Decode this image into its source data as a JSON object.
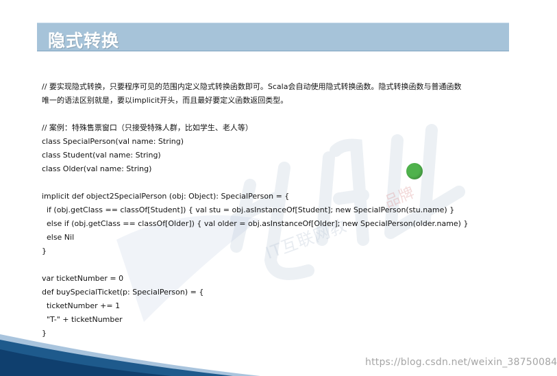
{
  "slide": {
    "title": "隐式转换",
    "lines": [
      "// 要实现隐式转换，只要程序可见的范围内定义隐式转换函数即可。Scala会自动使用隐式转换函数。隐式转换函数与普通函数",
      "唯一的语法区别就是，要以implicit开头，而且最好要定义函数返回类型。",
      "",
      "// 案例：特殊售票窗口（只接受特殊人群，比如学生、老人等）",
      "class SpecialPerson(val name: String)",
      "class Student(val name: String)",
      "class Older(val name: String)",
      "",
      "implicit def object2SpecialPerson (obj: Object): SpecialPerson = {",
      "  if (obj.getClass == classOf[Student]) { val stu = obj.asInstanceOf[Student]; new SpecialPerson(stu.name) }",
      "  else if (obj.getClass == classOf[Older]) { val older = obj.asInstanceOf[Older]; new SpecialPerson(older.name) }",
      "  else Nil",
      "}",
      "",
      "var ticketNumber = 0",
      "def buySpecialTicket(p: SpecialPerson) = {",
      "  ticketNumber += 1",
      "  \"T-\" + ticketNumber",
      "}"
    ]
  },
  "watermark": {
    "brand": "品牌",
    "sub": "IT互联网教",
    "url": "https://blog.csdn.net/weixin_38750084"
  },
  "colors": {
    "title_bar": "#a6c3d9",
    "title_text": "#ffffff",
    "dot": "#4fb24c",
    "bottom_shape": "#1e5a8c"
  },
  "icons": {
    "watermark_logo": "bifeng-logo-icon",
    "dot": "green-dot-icon"
  }
}
